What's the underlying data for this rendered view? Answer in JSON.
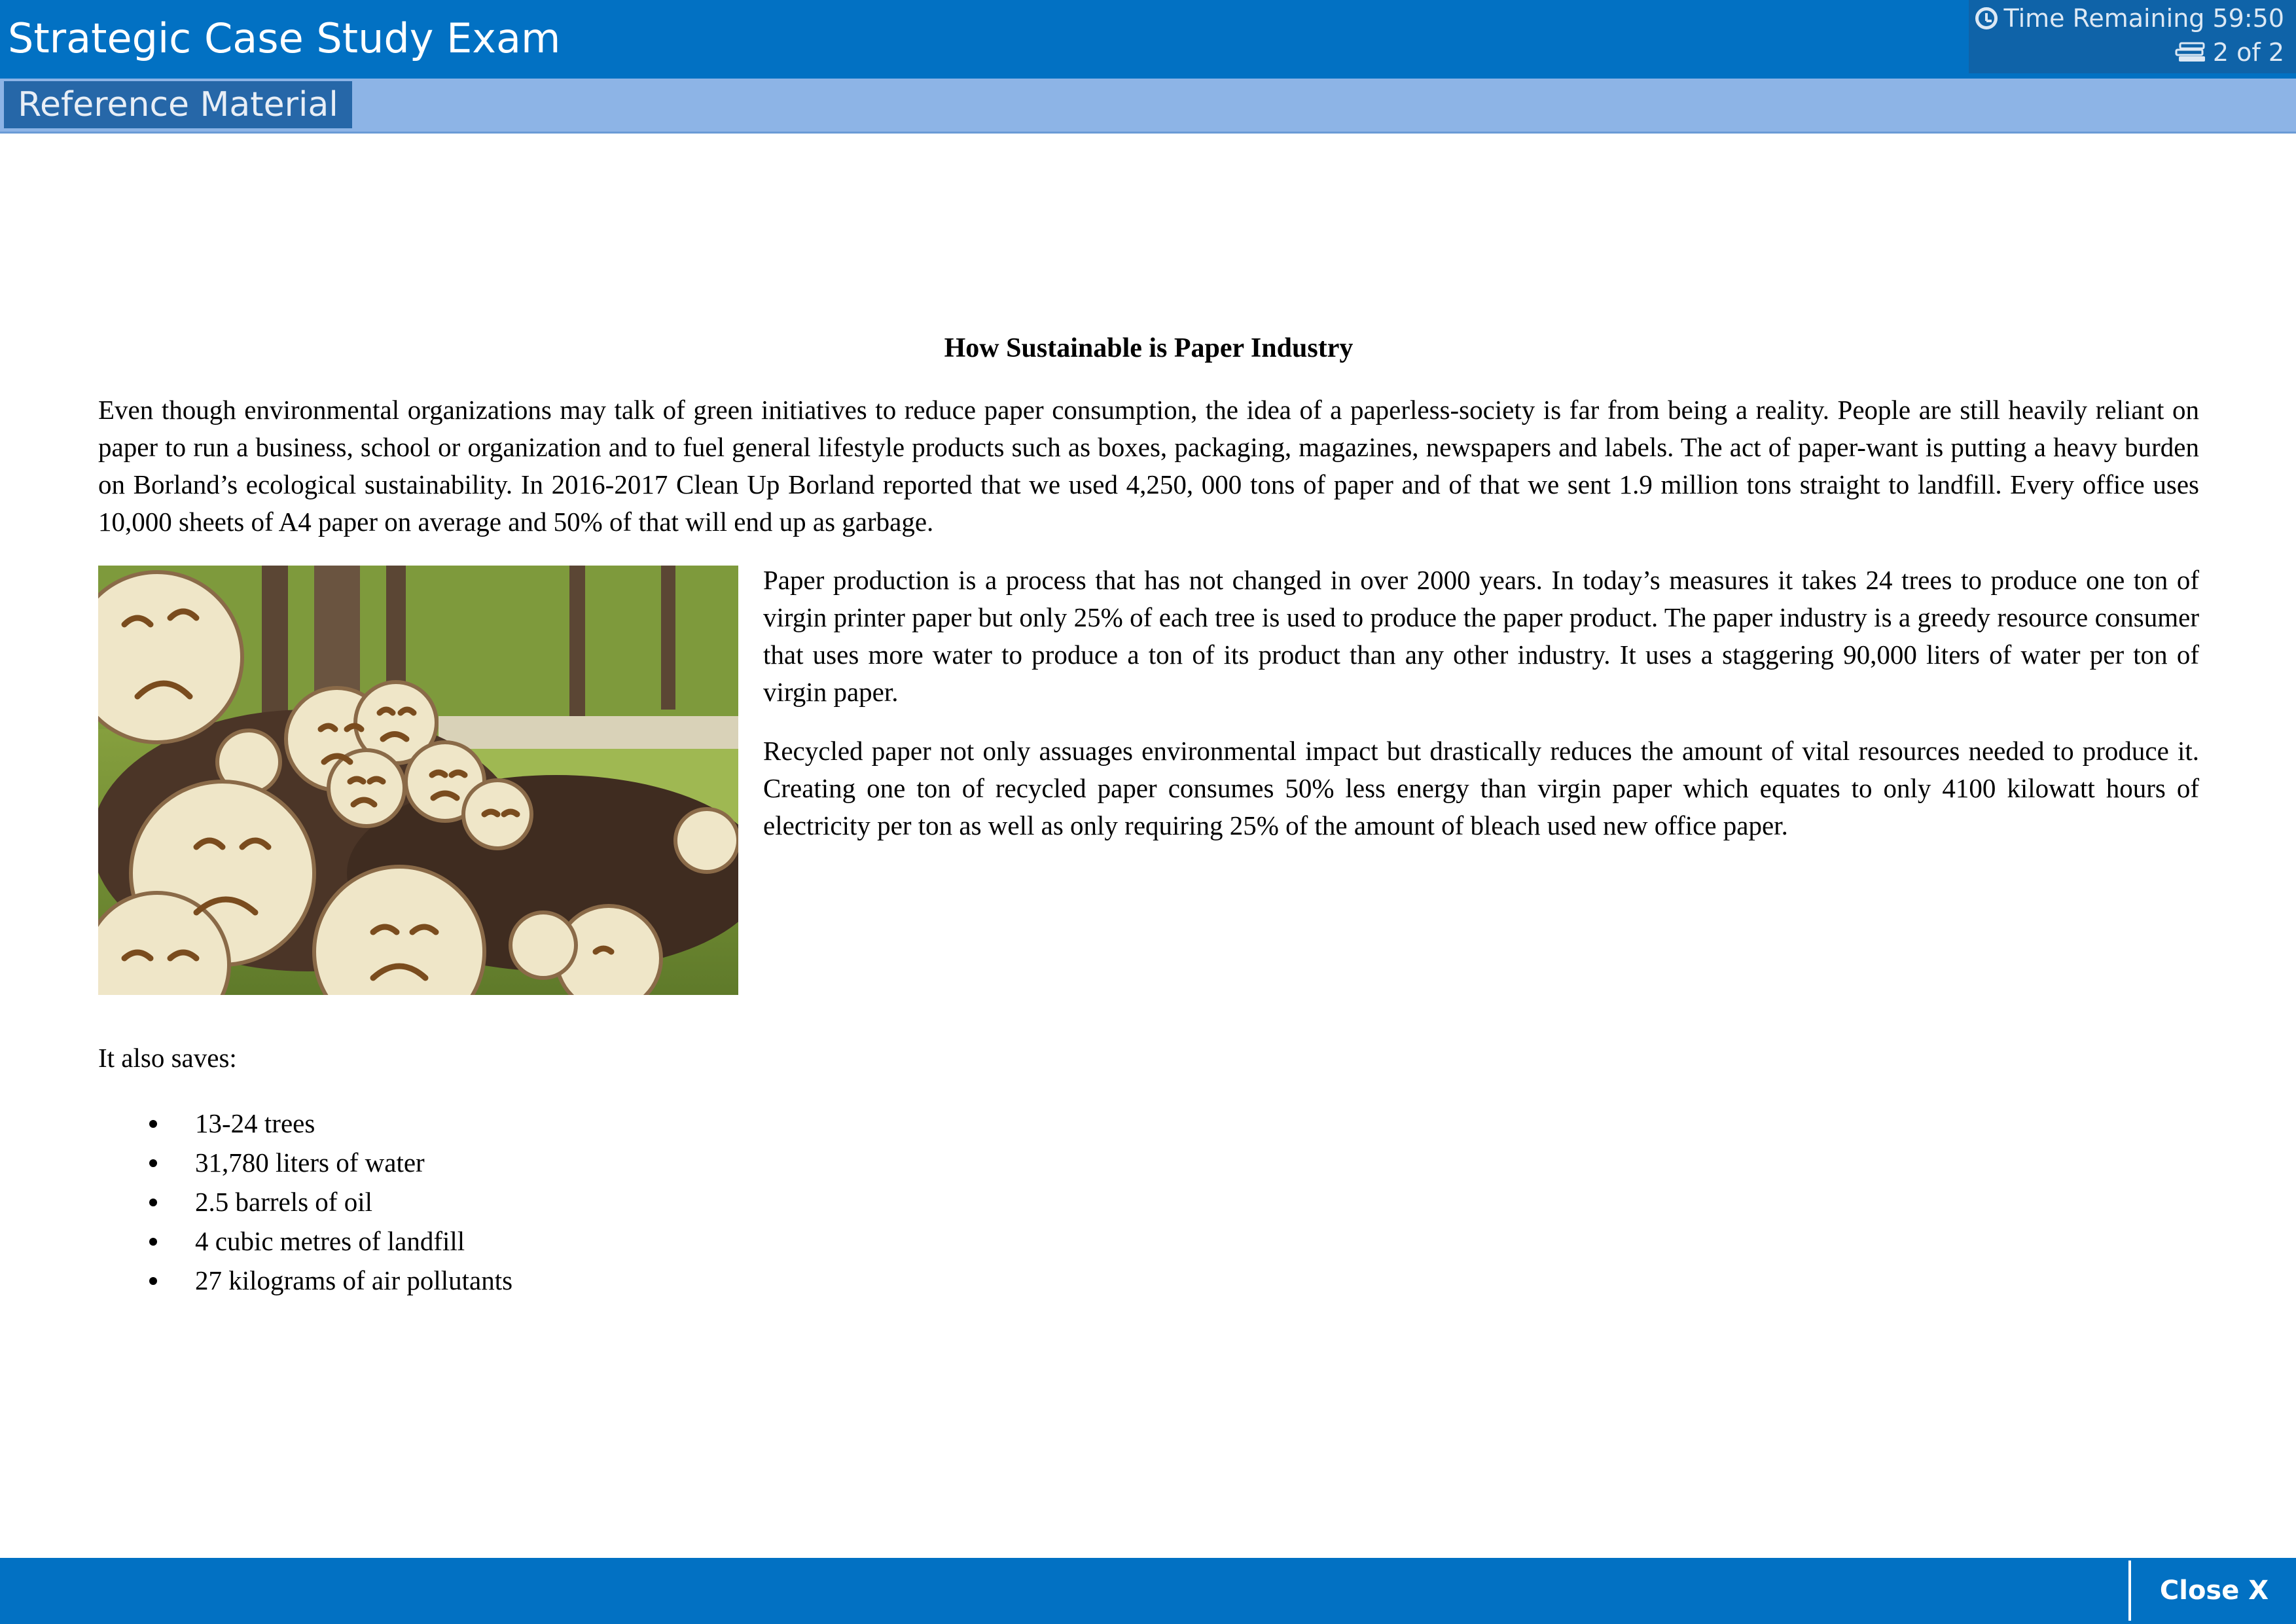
{
  "header": {
    "title": "Strategic Case Study Exam",
    "time_remaining": "Time Remaining 59:50",
    "page_indicator": "2 of 2",
    "icons": [
      "clock-icon",
      "pages-icon"
    ]
  },
  "subheader": {
    "tab_label": "Reference Material"
  },
  "document": {
    "title": "How Sustainable is Paper Industry",
    "paragraph_1": "Even though environmental organizations may talk of green initiatives to reduce paper consumption, the idea of a paperless-society is far from being a reality. People are still heavily reliant on paper to run a business, school or organization and to fuel general lifestyle products such as boxes, packaging, magazines, newspapers and labels. The act of paper-want is putting a heavy burden on Borland’s ecological sustainability. In 2016-2017 Clean Up Borland reported that we used 4,250, 000 tons of paper and of that we sent 1.9 million tons straight to landfill. Every office uses 10,000 sheets of A4 paper on average and 50% of that will end up as garbage.",
    "paragraph_2": "Paper production is a process that has not changed in over 2000 years. In today’s measures it takes 24 trees to produce one ton of virgin printer paper but only 25% of each tree is used to produce the paper product. The paper industry is a greedy resource consumer that uses more water to produce a ton of its product than any other industry. It uses a staggering 90,000 liters of water per ton of virgin paper.",
    "paragraph_3": "Recycled paper not only assuages environmental impact but drastically reduces the amount of vital resources needed to produce it. Creating one ton of recycled paper consumes 50% less energy than virgin paper which equates to only 4100 kilowatt hours of electricity per ton as well as only requiring 25% of the amount of bleach used new office paper.",
    "also_saves_label": "It also saves:",
    "savings": [
      "13-24 trees",
      "31,780 liters of water",
      "2.5 barrels of oil",
      "4 cubic metres of landfill",
      "27 kilograms of air pollutants"
    ]
  },
  "footer": {
    "close_label": "Close X"
  }
}
